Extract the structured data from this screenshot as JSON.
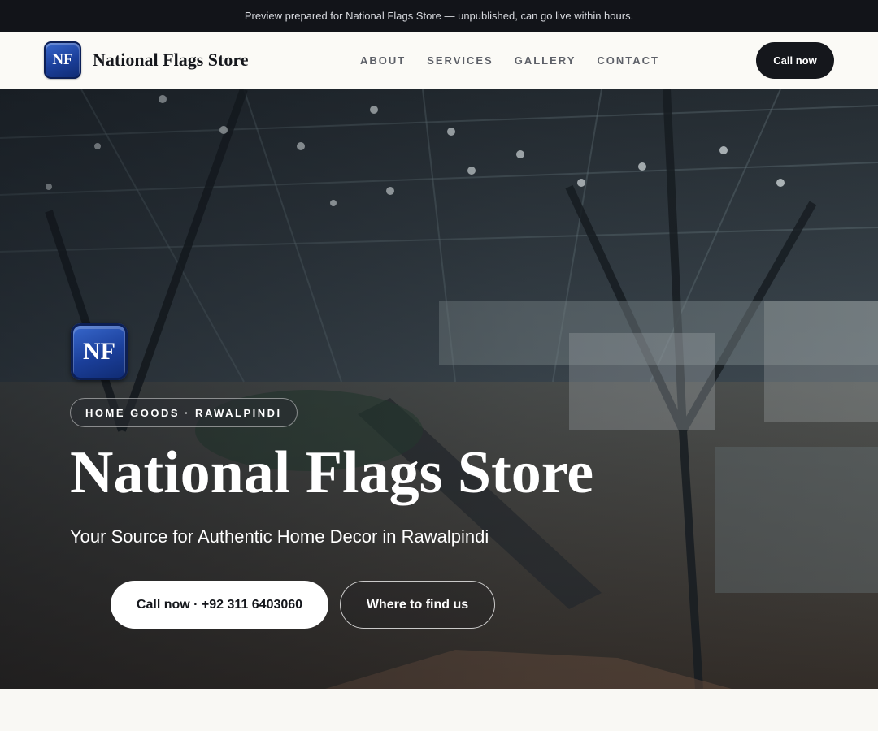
{
  "preview_bar": {
    "text": "Preview prepared for National Flags Store — unpublished, can go live within hours."
  },
  "header": {
    "logo_initials": "NF",
    "brand_name": "National Flags Store",
    "nav": [
      {
        "label": "ABOUT"
      },
      {
        "label": "SERVICES"
      },
      {
        "label": "GALLERY"
      },
      {
        "label": "CONTACT"
      }
    ],
    "cta_label": "Call now"
  },
  "hero": {
    "logo_initials": "NF",
    "tag": "HOME GOODS · RAWALPINDI",
    "title": "National Flags Store",
    "subtitle": "Your Source for Authentic Home Decor in Rawalpindi",
    "primary_button": "Call now · +92 311 6403060",
    "secondary_button": "Where to find us",
    "background_description": "shopping-mall-interior-photo"
  },
  "colors": {
    "dark": "#15171c",
    "logo_blue": "#1b3f9a",
    "page_bg": "#f9f8f4"
  }
}
